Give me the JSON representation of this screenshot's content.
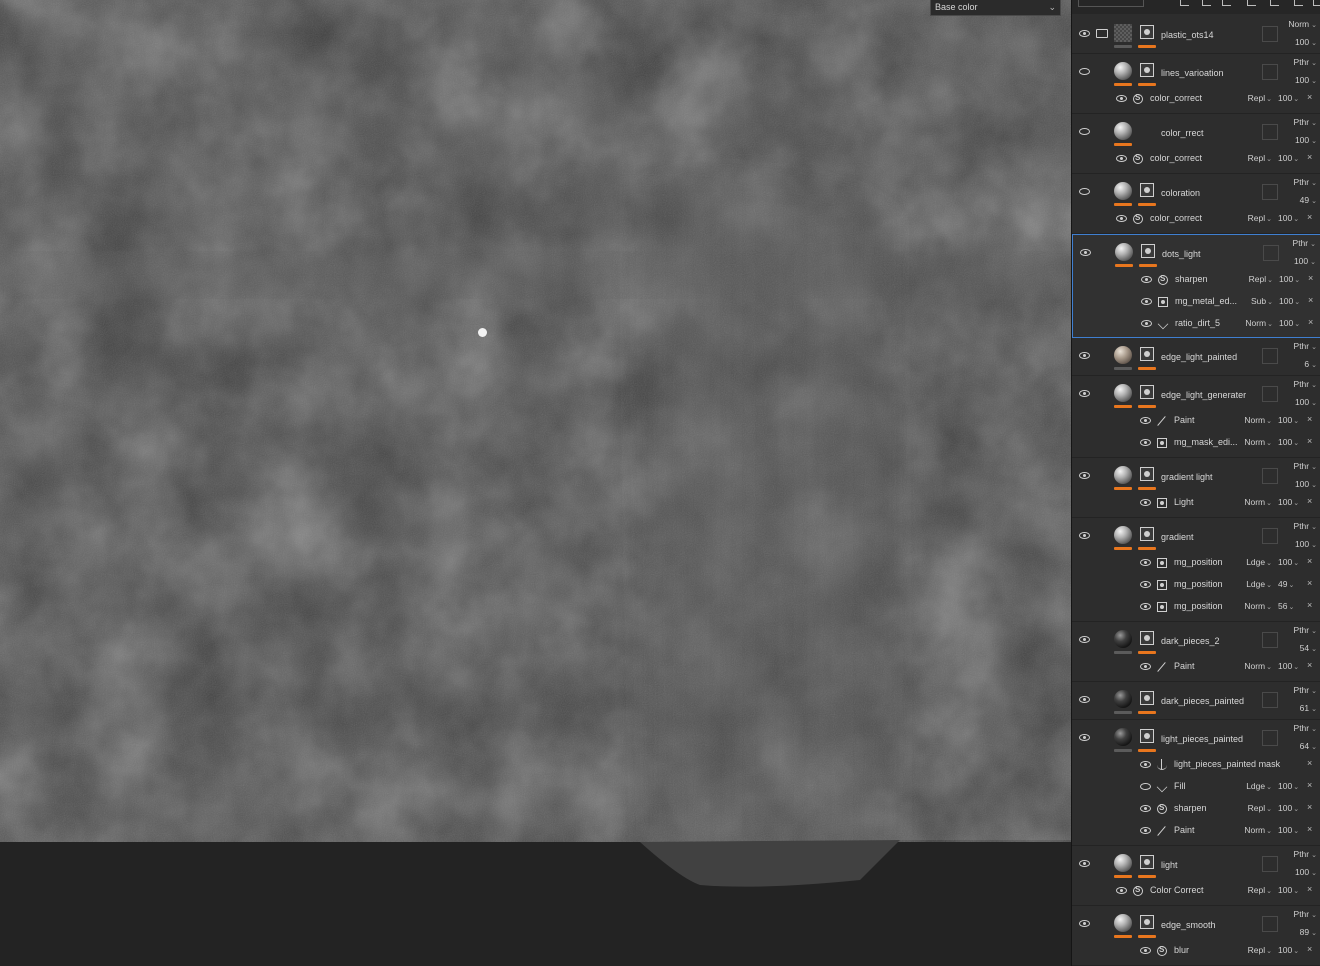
{
  "viewport": {
    "channel": "Base color"
  },
  "layers": [
    {
      "name": "plastic_ots14",
      "thumb": "checker",
      "folder": true,
      "eye": "on",
      "blend": "Norm",
      "opacity": "100",
      "bars": [
        "gray",
        "orange"
      ],
      "subs": []
    },
    {
      "name": "lines_varioation",
      "thumb": "ball",
      "eye": "off",
      "blend": "Pthr",
      "opacity": "100",
      "bars": [
        "orange",
        "orange"
      ],
      "subs": [
        {
          "name": "color_correct",
          "icon": "fx",
          "indent": 1,
          "eye": "on",
          "blend": "Repl",
          "opacity": "100"
        }
      ]
    },
    {
      "name": "color_rrect",
      "thumb": "ball",
      "nomask": true,
      "eye": "off",
      "blend": "Pthr",
      "opacity": "100",
      "bars": [
        "orange"
      ],
      "subs": [
        {
          "name": "color_correct",
          "icon": "fx",
          "indent": 1,
          "eye": "on",
          "blend": "Repl",
          "opacity": "100"
        }
      ]
    },
    {
      "name": "coloration",
      "thumb": "ball",
      "eye": "off",
      "blend": "Pthr",
      "opacity": "49",
      "bars": [
        "orange",
        "orange"
      ],
      "subs": [
        {
          "name": "color_correct",
          "icon": "fx",
          "indent": 1,
          "eye": "on",
          "blend": "Repl",
          "opacity": "100"
        }
      ]
    },
    {
      "name": "dots_light",
      "thumb": "ball",
      "eye": "on",
      "selected": true,
      "blend": "Pthr",
      "opacity": "100",
      "bars": [
        "orange",
        "orange"
      ],
      "subs": [
        {
          "name": "sharpen",
          "icon": "fx",
          "indent": 2,
          "eye": "on",
          "blend": "Repl",
          "opacity": "100"
        },
        {
          "name": "mg_metal_ed...",
          "icon": "mask",
          "indent": 2,
          "eye": "on",
          "blend": "Sub",
          "opacity": "100"
        },
        {
          "name": "ratio_dirt_5",
          "icon": "fill",
          "indent": 2,
          "eye": "on",
          "blend": "Norm",
          "opacity": "100"
        }
      ]
    },
    {
      "name": "edge_light_painted",
      "thumb": "warm",
      "eye": "on",
      "blend": "Pthr",
      "opacity": "6",
      "bars": [
        "gray",
        "orange"
      ],
      "subs": []
    },
    {
      "name": "edge_light_generater",
      "thumb": "ball",
      "eye": "on",
      "blend": "Pthr",
      "opacity": "100",
      "bars": [
        "orange",
        "orange"
      ],
      "subs": [
        {
          "name": "Paint",
          "icon": "paint",
          "indent": 2,
          "eye": "on",
          "blend": "Norm",
          "opacity": "100"
        },
        {
          "name": "mg_mask_edi...",
          "icon": "mask",
          "indent": 2,
          "eye": "on",
          "blend": "Norm",
          "opacity": "100"
        }
      ]
    },
    {
      "name": "gradient light",
      "thumb": "ball",
      "eye": "on",
      "blend": "Pthr",
      "opacity": "100",
      "bars": [
        "orange",
        "orange"
      ],
      "subs": [
        {
          "name": "Light",
          "icon": "mask",
          "indent": 2,
          "eye": "on",
          "blend": "Norm",
          "opacity": "100"
        }
      ]
    },
    {
      "name": "gradient",
      "thumb": "ball",
      "eye": "on",
      "blend": "Pthr",
      "opacity": "100",
      "bars": [
        "orange",
        "orange"
      ],
      "subs": [
        {
          "name": "mg_position",
          "icon": "mask",
          "indent": 2,
          "eye": "on",
          "blend": "Ldge",
          "opacity": "100"
        },
        {
          "name": "mg_position",
          "icon": "mask",
          "indent": 2,
          "eye": "on",
          "blend": "Ldge",
          "opacity": "49"
        },
        {
          "name": "mg_position",
          "icon": "mask",
          "indent": 2,
          "eye": "on",
          "blend": "Norm",
          "opacity": "56"
        }
      ]
    },
    {
      "name": "dark_pieces_2",
      "thumb": "dark",
      "eye": "on",
      "blend": "Pthr",
      "opacity": "54",
      "bars": [
        "gray",
        "orange"
      ],
      "subs": [
        {
          "name": "Paint",
          "icon": "paint",
          "indent": 2,
          "eye": "on",
          "blend": "Norm",
          "opacity": "100"
        }
      ]
    },
    {
      "name": "dark_pieces_painted",
      "thumb": "dark",
      "eye": "on",
      "blend": "Pthr",
      "opacity": "61",
      "bars": [
        "gray",
        "orange"
      ],
      "subs": []
    },
    {
      "name": "light_pieces_painted",
      "thumb": "dark",
      "eye": "on",
      "blend": "Pthr",
      "opacity": "64",
      "bars": [
        "gray",
        "orange"
      ],
      "subs": [
        {
          "name": "light_pieces_painted mask",
          "icon": "anchor",
          "indent": 2,
          "eye": "on",
          "blend": "",
          "opacity": "",
          "close": "normal"
        },
        {
          "name": "Fill",
          "icon": "fill",
          "indent": 2,
          "eye": "off",
          "blend": "Ldge",
          "opacity": "100",
          "close": "red"
        },
        {
          "name": "sharpen",
          "icon": "fx",
          "indent": 2,
          "eye": "on",
          "blend": "Repl",
          "opacity": "100",
          "close": "red"
        },
        {
          "name": "Paint",
          "icon": "paint",
          "indent": 2,
          "eye": "on",
          "blend": "Norm",
          "opacity": "100",
          "close": "red"
        }
      ]
    },
    {
      "name": "light",
      "thumb": "ball",
      "eye": "on",
      "blend": "Pthr",
      "opacity": "100",
      "bars": [
        "orange",
        "orange"
      ],
      "subs": [
        {
          "name": "Color Correct",
          "icon": "fx",
          "indent": 1,
          "eye": "on",
          "blend": "Repl",
          "opacity": "100"
        }
      ]
    },
    {
      "name": "edge_smooth",
      "thumb": "ball",
      "eye": "on",
      "blend": "Pthr",
      "opacity": "89",
      "bars": [
        "orange",
        "orange"
      ],
      "subs": [
        {
          "name": "blur",
          "icon": "fx",
          "indent": 2,
          "eye": "on",
          "blend": "Repl",
          "opacity": "100"
        }
      ]
    }
  ]
}
